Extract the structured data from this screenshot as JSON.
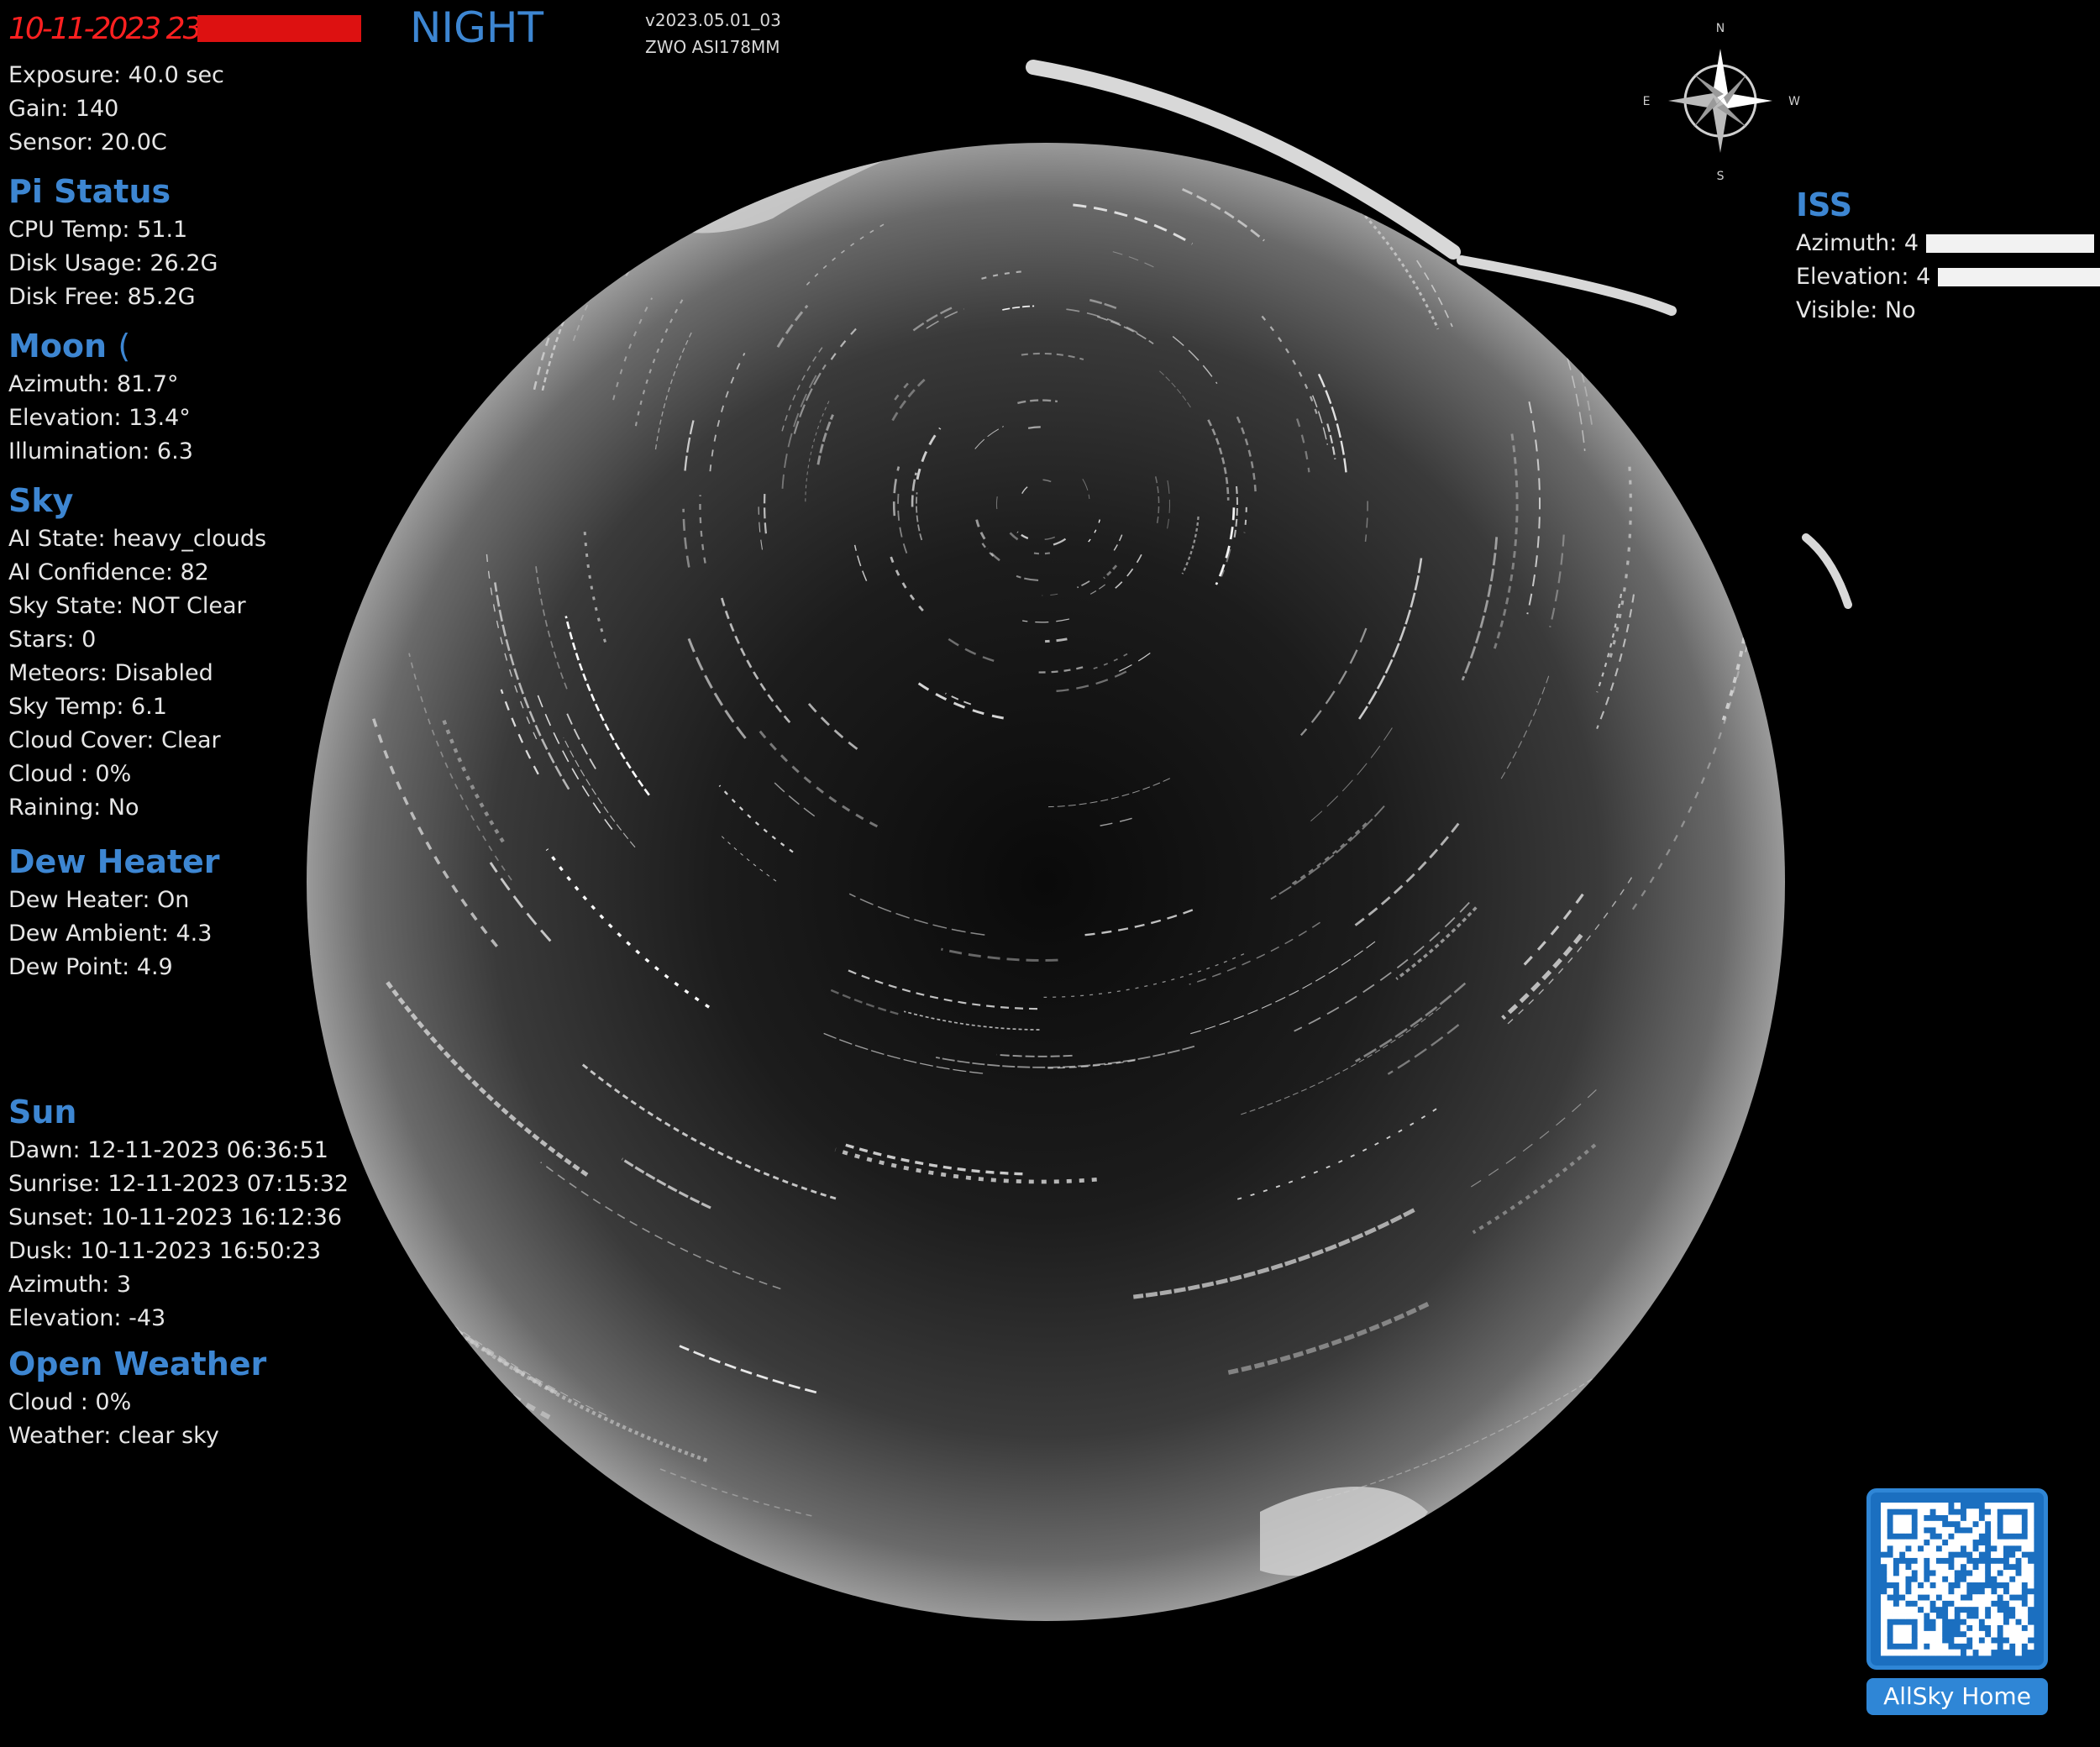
{
  "header": {
    "datetime": "10-11-2023 23:55",
    "mode": "NIGHT",
    "version": "v2023.05.01_03",
    "camera": "ZWO ASI178MM"
  },
  "camera_info": {
    "exposure": "Exposure: 40.0 sec",
    "gain": "Gain: 140",
    "sensor": "Sensor: 20.0C"
  },
  "pi_status": {
    "title": "Pi Status",
    "cpu_temp": "CPU Temp: 51.1",
    "disk_usage": "Disk Usage: 26.2G",
    "disk_free": "Disk Free: 85.2G"
  },
  "moon": {
    "title": "Moon",
    "phase_symbol": "(",
    "azimuth": "Azimuth: 81.7°",
    "elevation": "Elevation: 13.4°",
    "illumination": "Illumination: 6.3"
  },
  "sky": {
    "title": "Sky",
    "ai_state": "AI State: heavy_clouds",
    "ai_confidence": "AI Confidence: 82",
    "sky_state": "Sky State: NOT Clear",
    "stars": "Stars: 0",
    "meteors": "Meteors: Disabled",
    "sky_temp": "Sky Temp: 6.1",
    "cloud_cover": "Cloud Cover: Clear",
    "cloud": "Cloud : 0%",
    "raining": "Raining: No"
  },
  "dew_heater": {
    "title": "Dew Heater",
    "state": "Dew Heater: On",
    "ambient": "Dew Ambient: 4.3",
    "dew_point": "Dew Point: 4.9"
  },
  "sun": {
    "title": "Sun",
    "dawn": "Dawn: 12-11-2023 06:36:51",
    "sunrise": "Sunrise: 12-11-2023 07:15:32",
    "sunset": "Sunset: 10-11-2023 16:12:36",
    "dusk": "Dusk: 10-11-2023 16:50:23",
    "azimuth": "Azimuth: 3",
    "elevation": "Elevation: -43"
  },
  "open_weather": {
    "title": "Open Weather",
    "cloud": "Cloud : 0%",
    "weather": "Weather: clear sky"
  },
  "iss": {
    "title": "ISS",
    "azimuth": "Azimuth: 4",
    "elevation": "Elevation: 4",
    "visible": "Visible: No"
  },
  "compass": {
    "n": "N",
    "e": "E",
    "w": "W",
    "s": "S"
  },
  "qr": {
    "label": "AllSky Home"
  },
  "colors": {
    "accent": "#3d86d2",
    "datetime": "#ff2020",
    "qr": "#2f86d6"
  }
}
